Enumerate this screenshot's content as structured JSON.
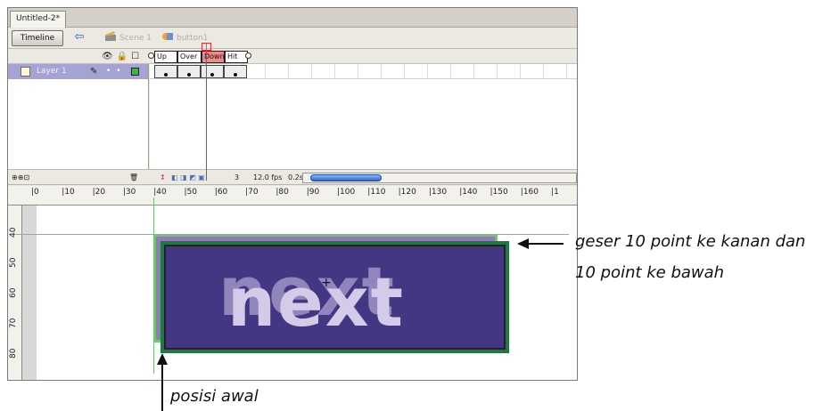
{
  "document": {
    "tab_title": "Untitled-2*"
  },
  "editbar": {
    "timeline_label": "Timeline",
    "back_icon": "left-arrow-icon",
    "scene_label": "Scene 1",
    "symbol_label": "button1"
  },
  "timeline": {
    "frame_labels": [
      "Up",
      "Over",
      "Down",
      "Hit"
    ],
    "active_frame_label": "Down",
    "layer": {
      "name": "Layer 1"
    },
    "footer": {
      "current_frame": "3",
      "frame_rate": "12.0 fps",
      "elapsed": "0.2s"
    }
  },
  "ruler": {
    "h_labels": [
      "0",
      "10",
      "20",
      "30",
      "40",
      "50",
      "60",
      "70",
      "80",
      "90",
      "100",
      "110",
      "120",
      "130",
      "140",
      "150",
      "160",
      "1"
    ],
    "v_labels": [
      "40",
      "50",
      "60",
      "70",
      "80"
    ]
  },
  "stage": {
    "button_text": "next"
  },
  "annotations": {
    "right_line1": "geser 10 point ke kanan dan",
    "right_line2": "10 point ke bawah",
    "bottom": "posisi awal"
  },
  "colors": {
    "layer_highlight": "#a5a3d3",
    "button_fill": "#433682",
    "button_original_fill": "#8f7cb5",
    "guide_green": "#74c274",
    "playhead_red": "#e03030",
    "down_label": "#f08a8a"
  }
}
